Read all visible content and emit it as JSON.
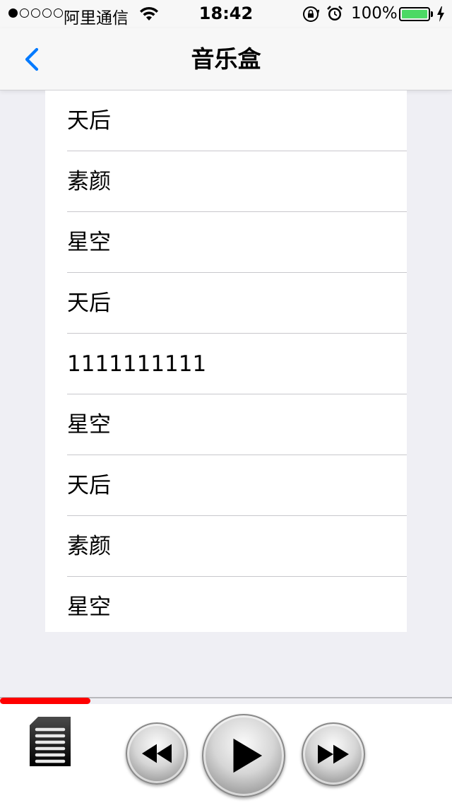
{
  "status_bar": {
    "carrier": "阿里通信",
    "time": "18:42",
    "battery_percent": "100%",
    "battery_level": 1.0,
    "signal_bars_filled": 1,
    "signal_bars_total": 5
  },
  "nav": {
    "title": "音乐盒",
    "back_icon": "chevron-left-icon"
  },
  "songs": [
    {
      "title": "天后"
    },
    {
      "title": "素颜"
    },
    {
      "title": "星空"
    },
    {
      "title": "天后"
    },
    {
      "title": "1111111111"
    },
    {
      "title": "星空"
    },
    {
      "title": "天后"
    },
    {
      "title": "素颜"
    },
    {
      "title": "星空"
    }
  ],
  "player": {
    "progress": 0.2,
    "playlist_icon": "playlist-icon",
    "prev_icon": "rewind-icon",
    "play_icon": "play-icon",
    "next_icon": "fast-forward-icon"
  },
  "colors": {
    "accent": "#007aff",
    "progress": "#ff0000",
    "battery": "#4cd964",
    "background": "#efeff4"
  }
}
